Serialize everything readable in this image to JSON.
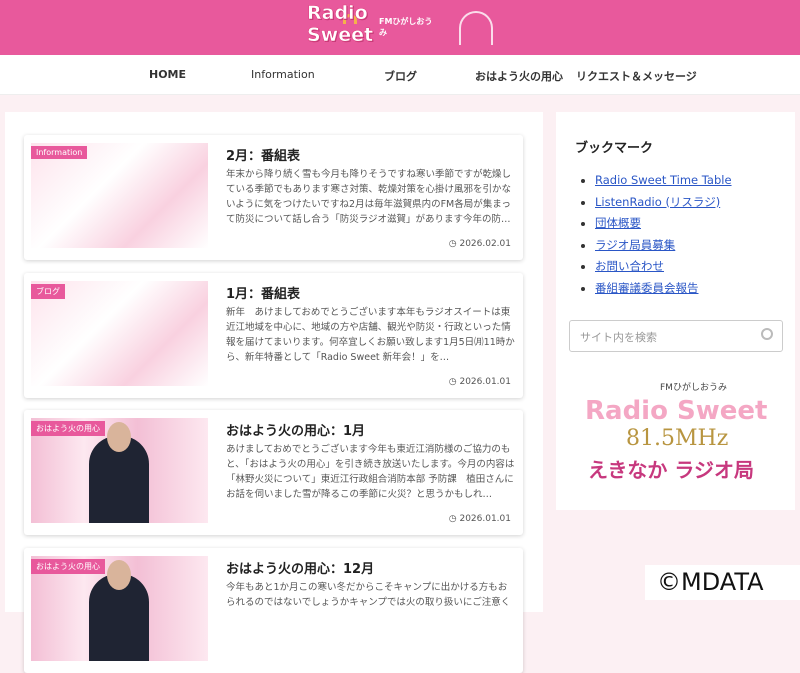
{
  "header": {
    "logo_text": "Radio Sweet",
    "logo_sub": "FMひがしおうみ"
  },
  "nav": [
    "HOME",
    "Information",
    "ブログ",
    "おはよう火の用心",
    "リクエスト＆メッセージ"
  ],
  "posts": [
    {
      "badge": "Information",
      "title": "2月：番組表",
      "excerpt": "年末から降り続く雪も今月も降りそうですね寒い季節ですが乾燥している季節でもあります寒さ対策、乾燥対策を心掛け風邪を引かないように気をつけたいですね2月は毎年滋賀県内のFM各局が集まって防災について話し合う「防災ラジオ滋賀」があります今年の防…",
      "date": "2026.02.01"
    },
    {
      "badge": "ブログ",
      "title": "1月：番組表",
      "excerpt": "新年　あけましておめでとうございます本年もラジオスイートは東近江地域を中心に、地域の方や店舗、観光や防災・行政といった情報を届けてまいります。何卒宜しくお願い致します1月5日㈪11時から、新年特番として「Radio Sweet 新年会！」を…",
      "date": "2026.01.01"
    },
    {
      "badge": "おはよう火の用心",
      "title": "おはよう火の用心：1月",
      "excerpt": "あけましておめでとうございます今年も東近江消防様のご協力のもと、「おはよう火の用心」を引き続き放送いたします。今月の内容は「林野火災について」東近江行政組合消防本部 予防課　植田さんにお話を伺いました雪が降るこの季節に火災？と思うかもしれ…",
      "date": "2026.01.01"
    },
    {
      "badge": "おはよう火の用心",
      "title": "おはよう火の用心：12月",
      "excerpt": "今年もあと1か月この寒い冬だからこそキャンプに出かける方もおられるのではないでしょうかキャンプでは火の取り扱いにご注意く",
      "date": ""
    }
  ],
  "sidebar": {
    "title": "ブックマーク",
    "links": [
      "Radio Sweet Time Table",
      "ListenRadio (リスラジ)",
      "団体概要",
      "ラジオ局員募集",
      "お問い合わせ",
      "番組審議委員会報告"
    ],
    "search_placeholder": "サイト内を検索",
    "logo": {
      "fm": "FMひがしおうみ",
      "name": "Radio Sweet",
      "freq": "81.5MHz",
      "tag": "えきなか ラジオ局"
    }
  },
  "watermark": "©MDATA"
}
